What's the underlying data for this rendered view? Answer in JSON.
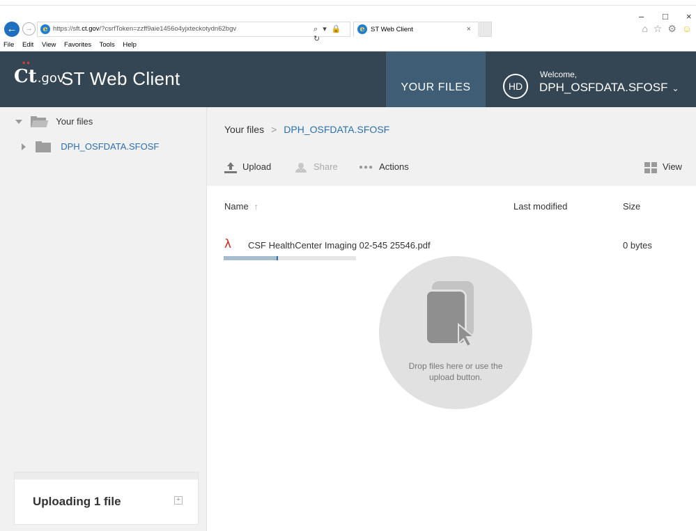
{
  "browser": {
    "url_prefix": "https://sft.",
    "url_domain": "ct.gov",
    "url_rest": "/?csrfToken=zzff9aie1456o4yjxteckotydn62bgv",
    "address_tools": "⌕ ▾ 🔒 ↻",
    "tab_title": "ST Web Client",
    "tab_close": "×",
    "menu": [
      "File",
      "Edit",
      "View",
      "Favorites",
      "Tools",
      "Help"
    ],
    "window_controls": {
      "minimize": "–",
      "maximize": "□",
      "close": "×"
    },
    "toolbar_icons": {
      "home": "⌂",
      "favorites": "☆",
      "settings": "⚙",
      "feedback": "☺"
    }
  },
  "header": {
    "logo_main": "Ct",
    "logo_accent": "••",
    "logo_suffix": ".gov",
    "app_title": "ST Web Client",
    "nav_tab": "YOUR FILES",
    "avatar_initials": "HD",
    "welcome": "Welcome,",
    "username": "DPH_OSFDATA.SFOSF",
    "caret": "⌄"
  },
  "sidebar": {
    "root_label": "Your files",
    "child_label": "DPH_OSFDATA.SFOSF",
    "upload_panel_title": "Uploading 1 file",
    "upload_panel_expand": "+"
  },
  "main": {
    "breadcrumb_root": "Your files",
    "breadcrumb_sep": ">",
    "breadcrumb_current": "DPH_OSFDATA.SFOSF",
    "toolbar": {
      "upload": "Upload",
      "share": "Share",
      "actions_dots": "●●●",
      "actions": "Actions",
      "view": "View"
    },
    "columns": {
      "name": "Name",
      "sort_arrow": "↑",
      "modified": "Last modified",
      "size": "Size"
    },
    "files": [
      {
        "name": "CSF HealthCenter Imaging 02-545  25546.pdf",
        "size": "0 bytes",
        "upload_progress": 0.41
      }
    ],
    "drop_zone_text": "Drop files here or use the upload button."
  },
  "colors": {
    "header_bg": "#344553",
    "active_tab_bg": "#3f5d74",
    "link": "#2a6fb3",
    "pdf_red": "#d8261f",
    "sidebar_bg": "#f1f1f1"
  },
  "icons": {
    "back": "arrow-left-icon",
    "forward": "arrow-right-icon",
    "pdf": "pdf-icon",
    "folder": "folder-icon",
    "upload": "upload-icon",
    "share": "share-icon",
    "view": "grid-view-icon"
  }
}
